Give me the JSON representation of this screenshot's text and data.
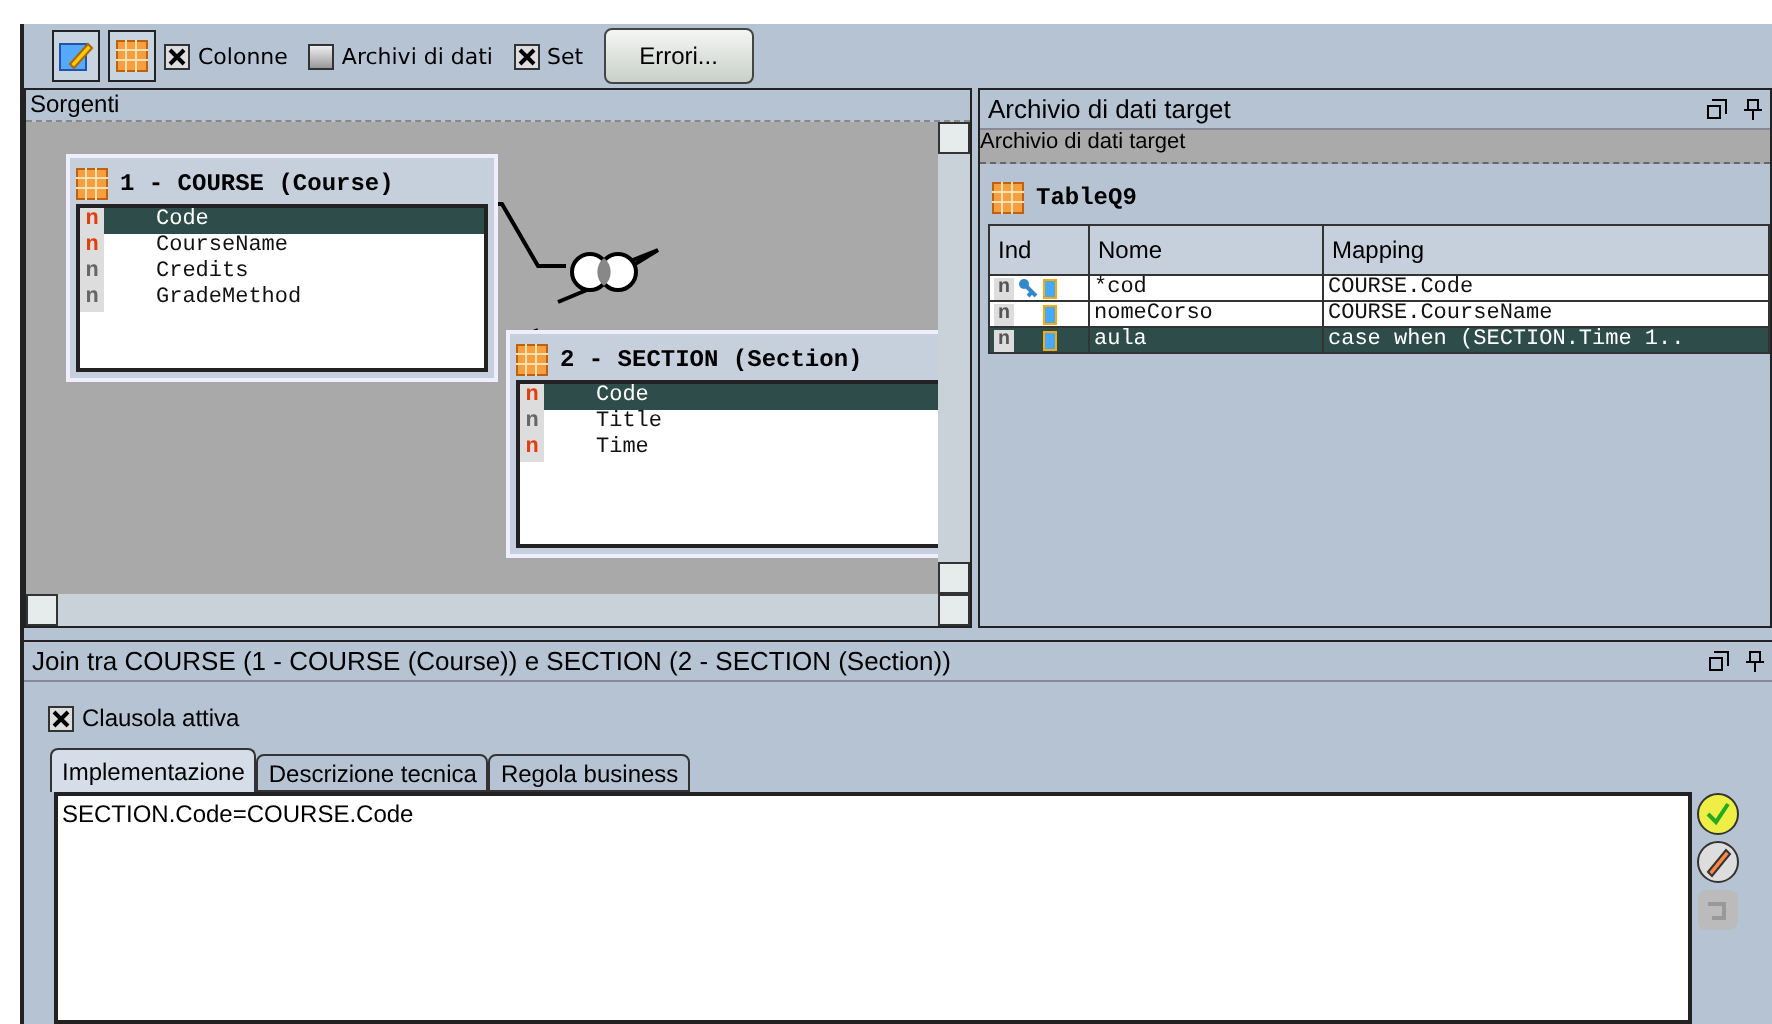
{
  "toolbar": {
    "checkboxes": [
      {
        "label": "Colonne",
        "checked": true
      },
      {
        "label": "Archivi di dati",
        "checked": false
      },
      {
        "label": "Set",
        "checked": true
      }
    ],
    "button": "Errori..."
  },
  "sources": {
    "title": "Sorgenti",
    "tables": [
      {
        "title": "1 - COURSE (Course)",
        "columns": [
          {
            "type": "n",
            "name": "Code",
            "required": true,
            "selected": true
          },
          {
            "type": "n",
            "name": "CourseName",
            "required": true,
            "selected": false
          },
          {
            "type": "n",
            "name": "Credits",
            "required": false,
            "selected": false
          },
          {
            "type": "n",
            "name": "GradeMethod",
            "required": false,
            "selected": false
          }
        ]
      },
      {
        "title": "2 - SECTION (Section)",
        "columns": [
          {
            "type": "n",
            "name": "Code",
            "required": true,
            "selected": true
          },
          {
            "type": "n",
            "name": "Title",
            "required": false,
            "selected": false
          },
          {
            "type": "n",
            "name": "Time",
            "required": true,
            "selected": false
          }
        ]
      }
    ]
  },
  "target": {
    "title": "Archivio di dati target",
    "subtitle": "Archivio di dati target",
    "table": {
      "title": "TableQ9",
      "columns": [
        "Ind",
        "Nome",
        "Mapping"
      ],
      "rows": [
        {
          "ind": "n",
          "key": true,
          "name": "*cod",
          "mapping": "COURSE.Code",
          "selected": false
        },
        {
          "ind": "n",
          "key": false,
          "name": "nomeCorso",
          "mapping": "COURSE.CourseName",
          "selected": false
        },
        {
          "ind": "n",
          "key": false,
          "name": "aula",
          "mapping": "case when (SECTION.Time 1..",
          "selected": true
        }
      ]
    }
  },
  "join": {
    "title": "Join tra COURSE (1 - COURSE (Course)) e SECTION (2 - SECTION (Section))",
    "active": {
      "label": "Clausola attiva",
      "checked": true
    },
    "tabs": [
      {
        "label": "Implementazione",
        "selected": true
      },
      {
        "label": "Descrizione tecnica",
        "selected": false
      },
      {
        "label": "Regola business",
        "selected": false
      }
    ],
    "expression": "SECTION.Code=COURSE.Code"
  }
}
